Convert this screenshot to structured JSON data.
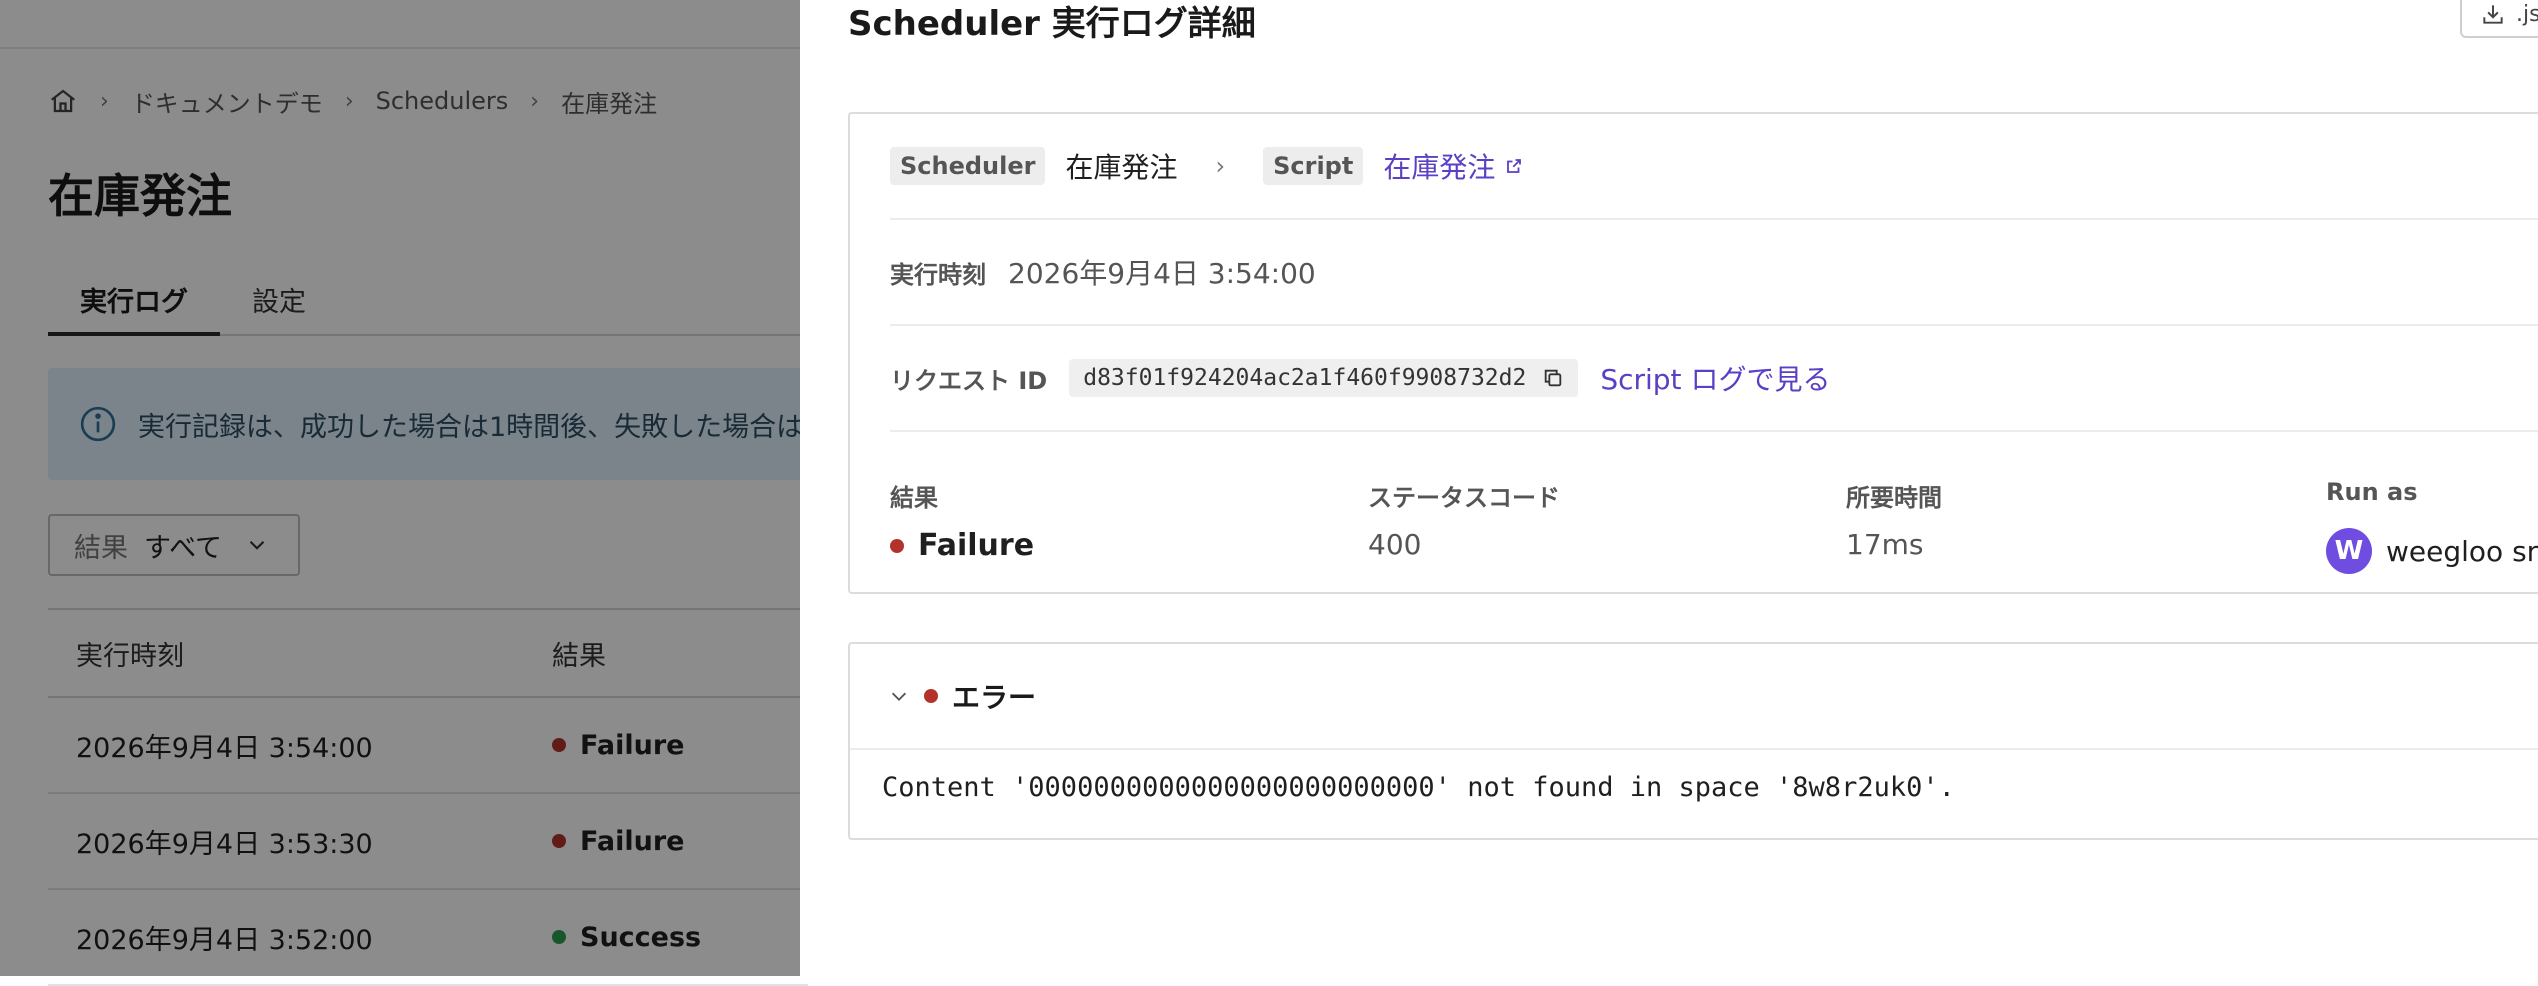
{
  "background": {
    "breadcrumb": [
      "ドキュメントデモ",
      "Schedulers",
      "在庫発注"
    ],
    "page_title": "在庫発注",
    "tabs": [
      {
        "label": "実行ログ",
        "active": true
      },
      {
        "label": "設定",
        "active": false
      }
    ],
    "info_text": "実行記録は、成功した場合は1時間後、失敗した場合は",
    "filter": {
      "label": "結果",
      "value": "すべて"
    },
    "table": {
      "columns": [
        "実行時刻",
        "結果"
      ],
      "rows": [
        {
          "time": "2026年9月4日 3:54:00",
          "result": "Failure"
        },
        {
          "time": "2026年9月4日 3:53:30",
          "result": "Failure"
        },
        {
          "time": "2026年9月4日 3:52:00",
          "result": "Success"
        }
      ]
    }
  },
  "drawer": {
    "title": "Scheduler 実行ログ詳細",
    "download_label": ".js",
    "scheduler_tag": "Scheduler",
    "scheduler_name": "在庫発注",
    "script_tag": "Script",
    "script_link": "在庫発注",
    "exec_time_label": "実行時刻",
    "exec_time_value": "2026年9月4日 3:54:00",
    "request_id_label": "リクエスト ID",
    "request_id_value": "d83f01f924204ac2a1f460f9908732d2",
    "script_log_link": "Script ログで見る",
    "stats": {
      "result": {
        "label": "結果",
        "value": "Failure"
      },
      "status_code": {
        "label": "ステータスコード",
        "value": "400"
      },
      "duration": {
        "label": "所要時間",
        "value": "17ms"
      },
      "run_as": {
        "label": "Run as",
        "avatar_initial": "W",
        "user": "weegloo sn"
      }
    },
    "error": {
      "title": "エラー",
      "message": "Content '0000000000000000000000000' not found in space '8w8r2uk0'."
    }
  },
  "colors": {
    "failure": "#b3332b",
    "success": "#2e9e4f",
    "link": "#5b3fc4",
    "avatar": "#6f4de0",
    "info_bg": "#e1f1fb"
  }
}
